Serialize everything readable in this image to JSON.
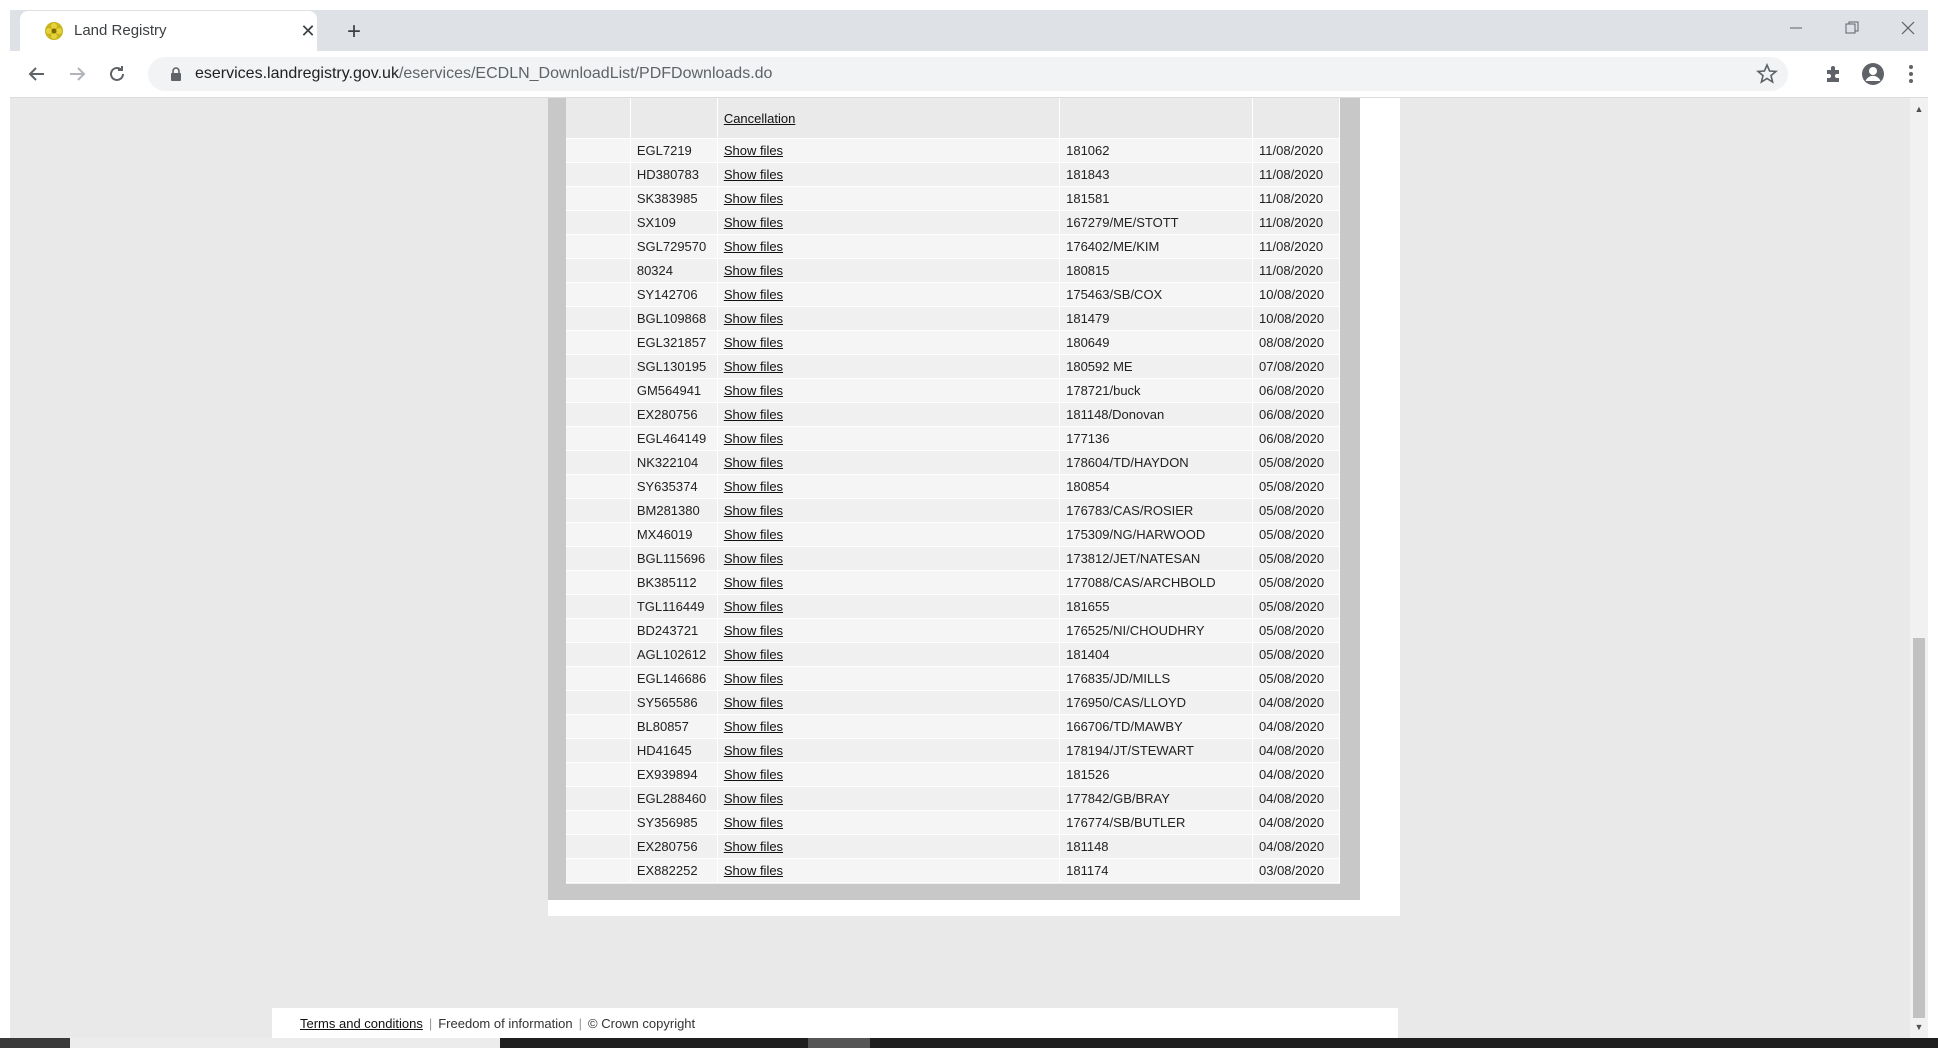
{
  "browser": {
    "tab_title": "Land Registry",
    "url_host": "eservices.landregistry.gov.uk",
    "url_path": "/eservices/ECDLN_DownloadList/PDFDownloads.do"
  },
  "table": {
    "header_col2": "Cancellation",
    "rows": [
      {
        "title": "EGL7219",
        "link": "Show files",
        "ref": "181062",
        "date": "11/08/2020"
      },
      {
        "title": "HD380783",
        "link": "Show files",
        "ref": "181843",
        "date": "11/08/2020"
      },
      {
        "title": "SK383985",
        "link": "Show files",
        "ref": "181581",
        "date": "11/08/2020"
      },
      {
        "title": "SX109",
        "link": "Show files",
        "ref": "167279/ME/STOTT",
        "date": "11/08/2020"
      },
      {
        "title": "SGL729570",
        "link": "Show files",
        "ref": "176402/ME/KIM",
        "date": "11/08/2020"
      },
      {
        "title": "80324",
        "link": "Show files",
        "ref": "180815",
        "date": "11/08/2020"
      },
      {
        "title": "SY142706",
        "link": "Show files",
        "ref": "175463/SB/COX",
        "date": "10/08/2020"
      },
      {
        "title": "BGL109868",
        "link": "Show files",
        "ref": "181479",
        "date": "10/08/2020"
      },
      {
        "title": "EGL321857",
        "link": "Show files",
        "ref": "180649",
        "date": "08/08/2020"
      },
      {
        "title": "SGL130195",
        "link": "Show files",
        "ref": "180592 ME",
        "date": "07/08/2020"
      },
      {
        "title": "GM564941",
        "link": "Show files",
        "ref": "178721/buck",
        "date": "06/08/2020"
      },
      {
        "title": "EX280756",
        "link": "Show files",
        "ref": "181148/Donovan",
        "date": "06/08/2020"
      },
      {
        "title": "EGL464149",
        "link": "Show files",
        "ref": "177136",
        "date": "06/08/2020"
      },
      {
        "title": "NK322104",
        "link": "Show files",
        "ref": "178604/TD/HAYDON",
        "date": "05/08/2020"
      },
      {
        "title": "SY635374",
        "link": "Show files",
        "ref": "180854",
        "date": "05/08/2020"
      },
      {
        "title": "BM281380",
        "link": "Show files",
        "ref": "176783/CAS/ROSIER",
        "date": "05/08/2020"
      },
      {
        "title": "MX46019",
        "link": "Show files",
        "ref": "175309/NG/HARWOOD",
        "date": "05/08/2020"
      },
      {
        "title": "BGL115696",
        "link": "Show files",
        "ref": "173812/JET/NATESAN",
        "date": "05/08/2020"
      },
      {
        "title": "BK385112",
        "link": "Show files",
        "ref": "177088/CAS/ARCHBOLD",
        "date": "05/08/2020"
      },
      {
        "title": "TGL116449",
        "link": "Show files",
        "ref": "181655",
        "date": "05/08/2020"
      },
      {
        "title": "BD243721",
        "link": "Show files",
        "ref": "176525/NI/CHOUDHRY",
        "date": "05/08/2020"
      },
      {
        "title": "AGL102612",
        "link": "Show files",
        "ref": "181404",
        "date": "05/08/2020"
      },
      {
        "title": "EGL146686",
        "link": "Show files",
        "ref": "176835/JD/MILLS",
        "date": "05/08/2020"
      },
      {
        "title": "SY565586",
        "link": "Show files",
        "ref": "176950/CAS/LLOYD",
        "date": "04/08/2020"
      },
      {
        "title": "BL80857",
        "link": "Show files",
        "ref": "166706/TD/MAWBY",
        "date": "04/08/2020"
      },
      {
        "title": "HD41645",
        "link": "Show files",
        "ref": "178194/JT/STEWART",
        "date": "04/08/2020"
      },
      {
        "title": "EX939894",
        "link": "Show files",
        "ref": "181526",
        "date": "04/08/2020"
      },
      {
        "title": "EGL288460",
        "link": "Show files",
        "ref": "177842/GB/BRAY",
        "date": "04/08/2020"
      },
      {
        "title": "SY356985",
        "link": "Show files",
        "ref": "176774/SB/BUTLER",
        "date": "04/08/2020"
      },
      {
        "title": "EX280756",
        "link": "Show files",
        "ref": "181148",
        "date": "04/08/2020"
      },
      {
        "title": "EX882252",
        "link": "Show files",
        "ref": "181174",
        "date": "03/08/2020"
      }
    ]
  },
  "footer": {
    "terms": "Terms and conditions",
    "foi": "Freedom of information",
    "copyright": "© Crown copyright"
  }
}
